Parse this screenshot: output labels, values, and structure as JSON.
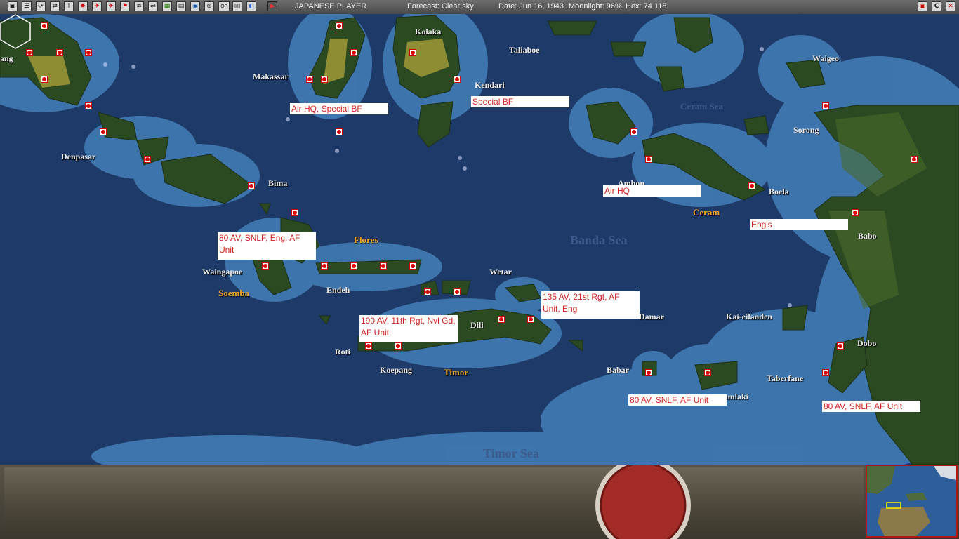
{
  "toolbar": {
    "buttons": [
      "▣",
      "☰",
      "⟳",
      "⇄",
      "i",
      "✸",
      "✈",
      "✈",
      "⚑",
      "≋",
      "⇌",
      "▦",
      "▤",
      "◉",
      "⊕",
      "OP",
      "▥",
      "◐"
    ],
    "end_turn_icon": "play-icon",
    "player": "JAPANESE PLAYER",
    "forecast": "Forecast: Clear sky",
    "date": "Date: Jun 16, 1943",
    "moonlight": "Moonlight: 96%",
    "hex": "Hex: 74 118",
    "right_buttons": [
      "▣",
      "C",
      "✕"
    ]
  },
  "places": [
    {
      "id": "kolaka",
      "name": "Kolaka"
    },
    {
      "id": "taliaboe",
      "name": "Taliaboe"
    },
    {
      "id": "waigeo",
      "name": "Waigeo"
    },
    {
      "id": "makassar",
      "name": "Makassar"
    },
    {
      "id": "kendari",
      "name": "Kendari"
    },
    {
      "id": "sorong",
      "name": "Sorong"
    },
    {
      "id": "denpasar",
      "name": "Denpasar"
    },
    {
      "id": "ambon",
      "name": "Ambon"
    },
    {
      "id": "bima",
      "name": "Bima"
    },
    {
      "id": "boela",
      "name": "Boela"
    },
    {
      "id": "babo",
      "name": "Babo"
    },
    {
      "id": "waingapoe",
      "name": "Waingapoe"
    },
    {
      "id": "endeh",
      "name": "Endeh"
    },
    {
      "id": "wetar",
      "name": "Wetar"
    },
    {
      "id": "damar",
      "name": "Damar"
    },
    {
      "id": "kai",
      "name": "Kai-eilanden"
    },
    {
      "id": "dili",
      "name": "Dili"
    },
    {
      "id": "dobo",
      "name": "Dobo"
    },
    {
      "id": "roti",
      "name": "Roti"
    },
    {
      "id": "koepang",
      "name": "Koepang"
    },
    {
      "id": "babar",
      "name": "Babar"
    },
    {
      "id": "taberfane",
      "name": "Taberfane"
    },
    {
      "id": "saumlaki",
      "name": "aumlaki"
    },
    {
      "id": "ang",
      "name": "ang"
    }
  ],
  "regions": {
    "flores": "Flores",
    "soemba": "Soemba",
    "timor": "Timor",
    "ceram": "Ceram"
  },
  "seas": {
    "banda": "Banda Sea",
    "ceram_sea": "Ceram Sea",
    "timor_sea": "Timor Sea"
  },
  "notes": [
    {
      "id": "makassar",
      "text": "Air HQ, Special BF"
    },
    {
      "id": "kendari",
      "text": "Special BF"
    },
    {
      "id": "ambon",
      "text": "Air HQ"
    },
    {
      "id": "boela",
      "text": "Eng's"
    },
    {
      "id": "waingapoe",
      "text": "80 AV, SNLF, Eng, AF Unit"
    },
    {
      "id": "dili",
      "text": "135 AV, 21st Rgt, AF Unit, Eng"
    },
    {
      "id": "koepang",
      "text": "190 AV, 11th Rgt, Nvl Gd, AF Unit"
    },
    {
      "id": "saumlaki",
      "text": "80 AV, SNLF, AF Unit"
    },
    {
      "id": "dobo",
      "text": "80 AV, SNLF, AF Unit"
    }
  ],
  "colors": {
    "deep_sea": "#1e3a68",
    "shallow_sea": "#3f78b0",
    "land": "#2c4a22",
    "marker": "#d00000",
    "note_text": "#d22323"
  }
}
